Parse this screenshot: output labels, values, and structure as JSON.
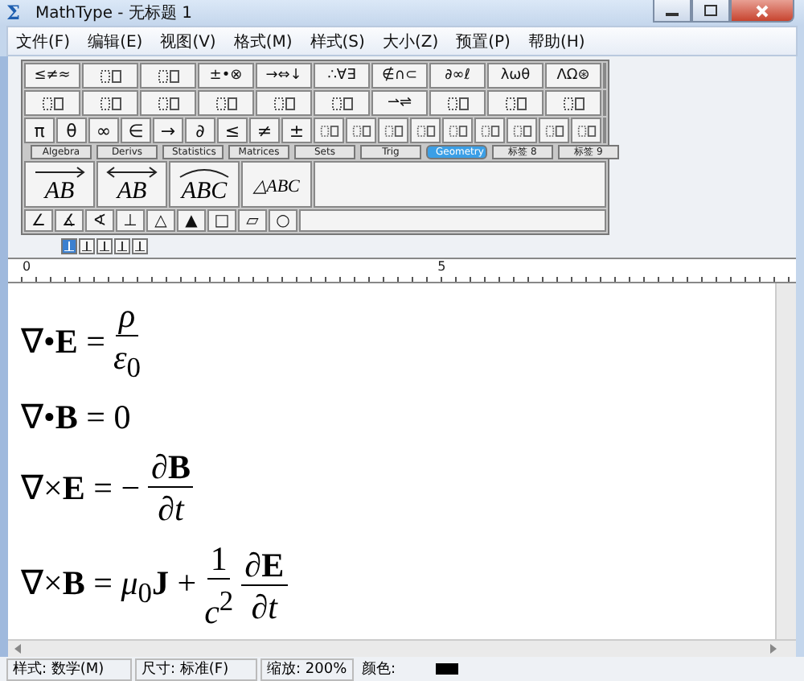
{
  "window": {
    "icon": "Σ",
    "title": "MathType - 无标题 1"
  },
  "menu": [
    "文件(F)",
    "编辑(E)",
    "视图(V)",
    "格式(M)",
    "样式(S)",
    "大小(Z)",
    "预置(P)",
    "帮助(H)"
  ],
  "palette": {
    "symbol_row": [
      {
        "kind": "symbols",
        "label": "≤≠≈"
      },
      {
        "kind": "template"
      },
      {
        "kind": "template"
      },
      {
        "kind": "symbols",
        "label": "±•⊗"
      },
      {
        "kind": "symbols",
        "label": "→⇔↓"
      },
      {
        "kind": "symbols",
        "label": "∴∀∃"
      },
      {
        "kind": "symbols",
        "label": "∉∩⊂"
      },
      {
        "kind": "symbols",
        "label": "∂∞ℓ"
      },
      {
        "kind": "symbols",
        "label": "λωθ"
      },
      {
        "kind": "symbols",
        "label": "ΛΩ⊛"
      }
    ],
    "template_row": [
      {
        "kind": "template"
      },
      {
        "kind": "template"
      },
      {
        "kind": "template"
      },
      {
        "kind": "template"
      },
      {
        "kind": "template"
      },
      {
        "kind": "template"
      },
      {
        "kind": "symbols",
        "label": "⇀⇌"
      },
      {
        "kind": "template"
      },
      {
        "kind": "template"
      },
      {
        "kind": "template"
      }
    ],
    "small_row": [
      {
        "kind": "symbols",
        "label": "π"
      },
      {
        "kind": "symbols",
        "label": "θ"
      },
      {
        "kind": "symbols",
        "label": "∞"
      },
      {
        "kind": "symbols",
        "label": "∈"
      },
      {
        "kind": "symbols",
        "label": "→"
      },
      {
        "kind": "symbols",
        "label": "∂"
      },
      {
        "kind": "symbols",
        "label": "≤"
      },
      {
        "kind": "symbols",
        "label": "≠"
      },
      {
        "kind": "symbols",
        "label": "±"
      },
      {
        "kind": "template"
      },
      {
        "kind": "template"
      },
      {
        "kind": "template"
      },
      {
        "kind": "template"
      },
      {
        "kind": "template"
      },
      {
        "kind": "template"
      },
      {
        "kind": "template"
      },
      {
        "kind": "template"
      },
      {
        "kind": "template"
      }
    ],
    "tabs": [
      {
        "label": "Algebra",
        "selected": false
      },
      {
        "label": "Derivs",
        "selected": false
      },
      {
        "label": "Statistics",
        "selected": false
      },
      {
        "label": "Matrices",
        "selected": false
      },
      {
        "label": "Sets",
        "selected": false
      },
      {
        "label": "Trig",
        "selected": false
      },
      {
        "label": "Geometry",
        "selected": true
      },
      {
        "label": "标签 8",
        "selected": false
      },
      {
        "label": "标签 9",
        "selected": false
      }
    ],
    "tab_items": [
      {
        "label": "AB",
        "kind": "rightarrow"
      },
      {
        "label": "AB",
        "kind": "botharrow"
      },
      {
        "label": "ABC",
        "kind": "arc"
      },
      {
        "label": "△ABC",
        "kind": "plain"
      }
    ],
    "geometry_row": [
      "∠",
      "∡",
      "∢",
      "⊥",
      "△",
      "▲",
      "□",
      "▱",
      "○"
    ]
  },
  "ruler": {
    "tab_stops": [
      {
        "selected": true
      },
      {
        "selected": false
      },
      {
        "selected": false
      },
      {
        "selected": false
      },
      {
        "selected": false
      }
    ],
    "labels": [
      "0",
      "5"
    ]
  },
  "equations": [
    {
      "parts": [
        {
          "kind": "text",
          "text": "∇•**E** ="
        },
        {
          "kind": "frac",
          "num": "*ρ*",
          "den": "*ε*$_{0}$"
        }
      ]
    },
    {
      "parts": [
        {
          "kind": "text",
          "text": "∇•**B** = 0"
        }
      ]
    },
    {
      "parts": [
        {
          "kind": "text",
          "text": "∇×**E** = −"
        },
        {
          "kind": "frac",
          "num": "∂**B**",
          "den": "∂*t*"
        }
      ]
    },
    {
      "parts": [
        {
          "kind": "text",
          "text": "∇×**B** = *μ*$_{0}$**J** +"
        },
        {
          "kind": "frac",
          "num": "1",
          "den": "*c*$^{2}$"
        },
        {
          "kind": "frac",
          "num": "∂**E**",
          "den": "∂*t*"
        }
      ]
    }
  ],
  "status_bar": {
    "style": "样式: 数学(M)",
    "size": "尺寸: 标准(F)",
    "zoom": "缩放: 200%",
    "color_label": "颜色:"
  }
}
